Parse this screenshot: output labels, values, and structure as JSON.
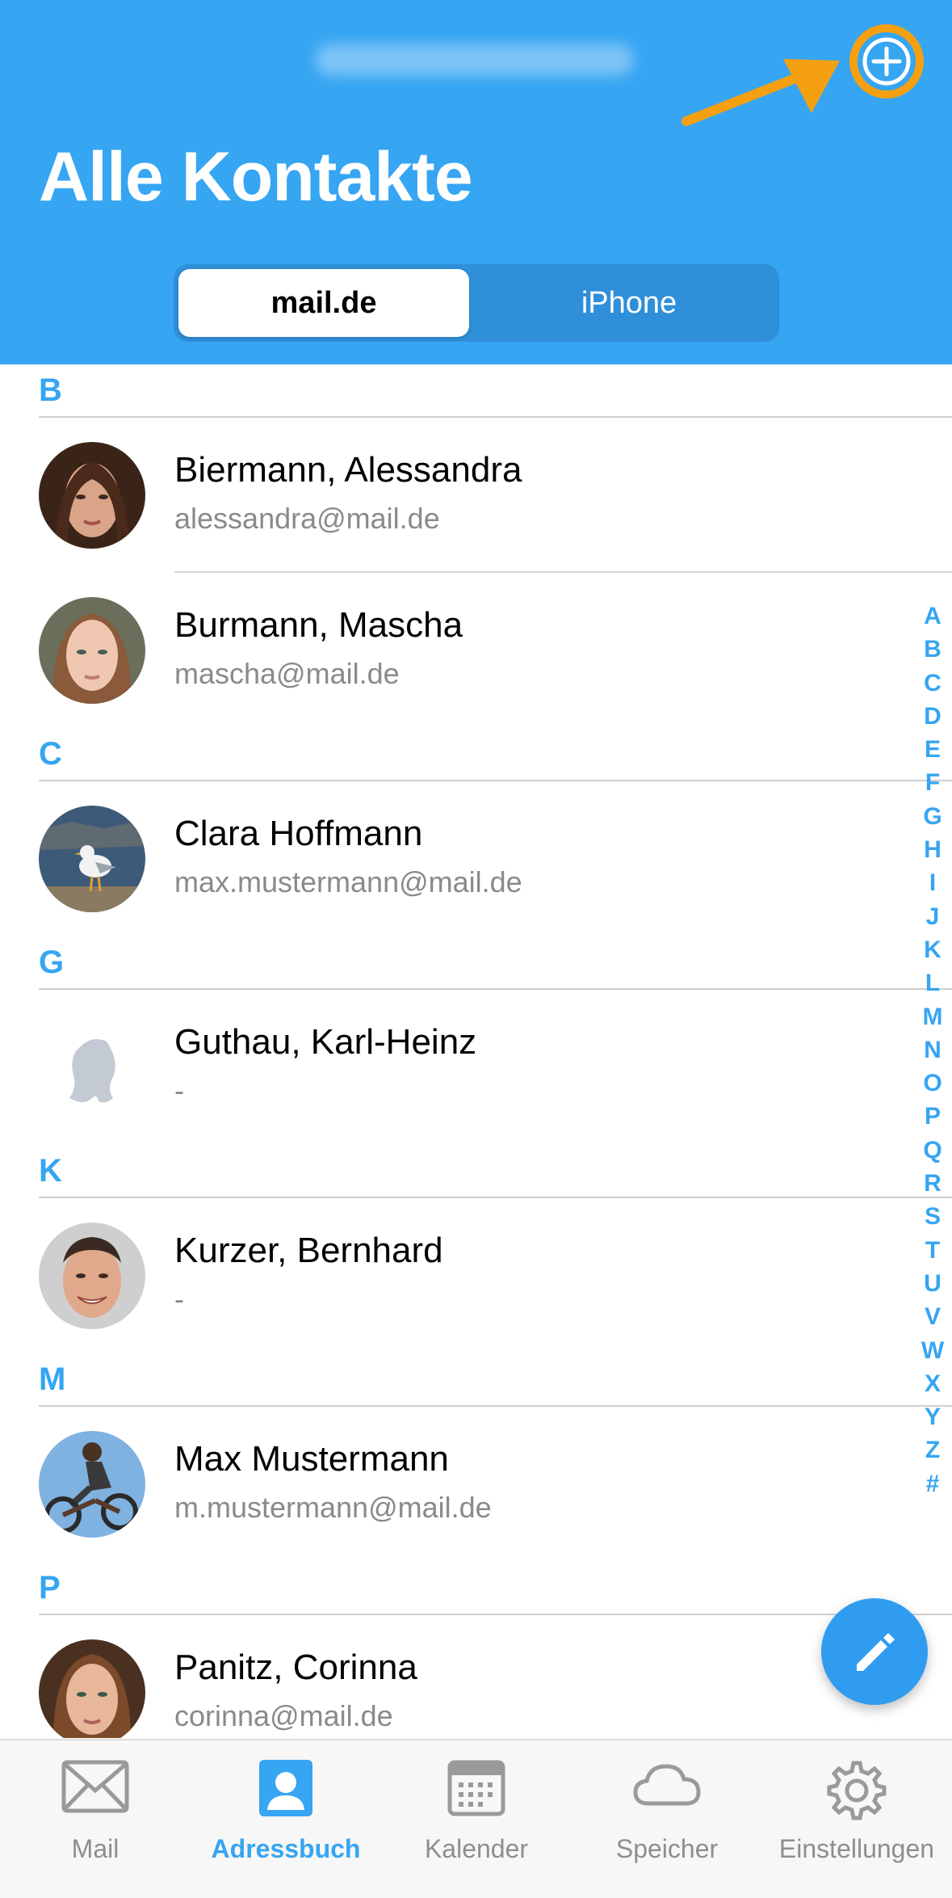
{
  "header": {
    "title": "Alle Kontakte",
    "account_email_blurred": "max.mustermann@mail.de",
    "add_button_label": "Kontakt hinzufügen",
    "segments": [
      {
        "label": "mail.de",
        "selected": true
      },
      {
        "label": "iPhone",
        "selected": false
      }
    ],
    "colors": {
      "header_bg": "#36a5f2",
      "highlight": "#f5a011"
    }
  },
  "sections": [
    {
      "letter": "B",
      "contacts": [
        {
          "name": "Biermann, Alessandra",
          "email": "alessandra@mail.de",
          "avatar": "photo-woman-dark-hair"
        },
        {
          "name": "Burmann, Mascha",
          "email": "mascha@mail.de",
          "avatar": "photo-woman-light-hair"
        }
      ]
    },
    {
      "letter": "C",
      "contacts": [
        {
          "name": "Clara Hoffmann",
          "email": "max.mustermann@mail.de",
          "avatar": "photo-seagull"
        }
      ]
    },
    {
      "letter": "G",
      "contacts": [
        {
          "name": "Guthau, Karl-Heinz",
          "email": "-",
          "avatar": "placeholder-silhouette"
        }
      ]
    },
    {
      "letter": "K",
      "contacts": [
        {
          "name": "Kurzer, Bernhard",
          "email": "-",
          "avatar": "photo-man-smiling"
        }
      ]
    },
    {
      "letter": "M",
      "contacts": [
        {
          "name": "Max Mustermann",
          "email": "m.mustermann@mail.de",
          "avatar": "photo-bmx-rider"
        }
      ]
    },
    {
      "letter": "P",
      "contacts": [
        {
          "name": "Panitz, Corinna",
          "email": "corinna@mail.de",
          "avatar": "photo-woman-brown-hair"
        }
      ]
    }
  ],
  "alphabet_index": [
    "A",
    "B",
    "C",
    "D",
    "E",
    "F",
    "G",
    "H",
    "I",
    "J",
    "K",
    "L",
    "M",
    "N",
    "O",
    "P",
    "Q",
    "R",
    "S",
    "T",
    "U",
    "V",
    "W",
    "X",
    "Y",
    "Z",
    "#"
  ],
  "fab": {
    "icon": "pencil-icon",
    "label": "Neue E-Mail"
  },
  "tabbar": {
    "tabs": [
      {
        "label": "Mail",
        "icon": "envelope-icon",
        "active": false
      },
      {
        "label": "Adressbuch",
        "icon": "contact-card-icon",
        "active": true
      },
      {
        "label": "Kalender",
        "icon": "calendar-icon",
        "active": false
      },
      {
        "label": "Speicher",
        "icon": "cloud-icon",
        "active": false
      },
      {
        "label": "Einstellungen",
        "icon": "gear-icon",
        "active": false
      }
    ]
  }
}
